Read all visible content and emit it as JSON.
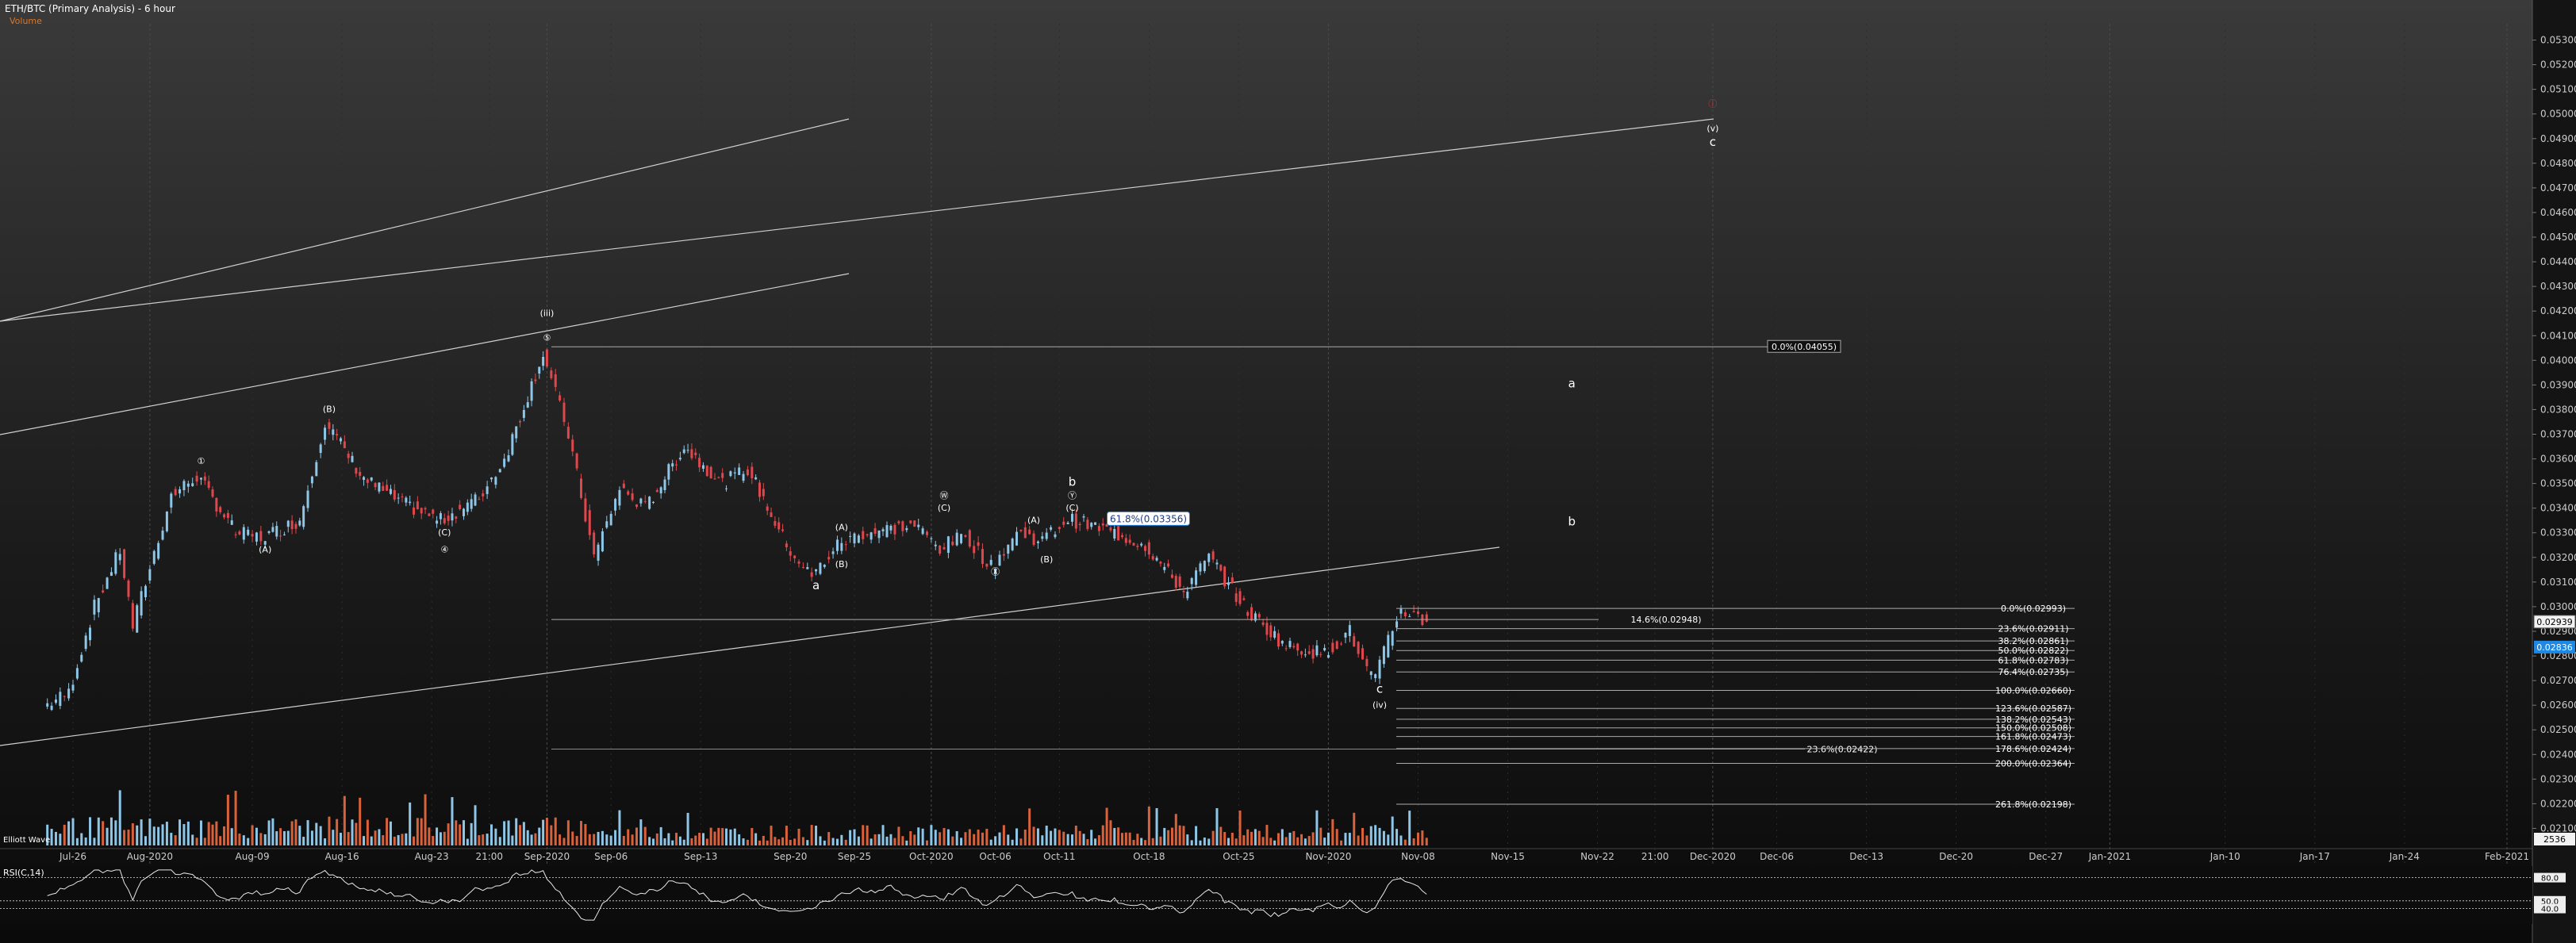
{
  "header": {
    "title": "ETH/BTC (Primary Analysis) - 6 hour",
    "volume_label": "Volume"
  },
  "volume_pane_label": "Elliott Wave",
  "chart_data": [
    {
      "type": "candlestick",
      "title": "ETH/BTC (Primary Analysis) - 6 hour",
      "x_tick_labels": [
        "Jul-26",
        "Aug-2020",
        "Aug-09",
        "Aug-16",
        "Aug-23",
        "21:00",
        "Sep-2020",
        "Sep-06",
        "Sep-13",
        "Sep-20",
        "Sep-25",
        "Oct-2020",
        "Oct-06",
        "Oct-11",
        "Oct-18",
        "Oct-25",
        "Nov-2020",
        "Nov-08",
        "Nov-15",
        "Nov-22",
        "21:00",
        "Dec-2020",
        "Dec-06",
        "Dec-13",
        "Dec-20",
        "Dec-27",
        "Jan-2021",
        "Jan-10",
        "Jan-17",
        "Jan-24",
        "Feb-2021"
      ],
      "y_tick_labels": [
        "0.02100",
        "0.02200",
        "0.02300",
        "0.02400",
        "0.02500",
        "0.02600",
        "0.02700",
        "0.02800",
        "0.02900",
        "0.03000",
        "0.03100",
        "0.03200",
        "0.03300",
        "0.03400",
        "0.03500",
        "0.03600",
        "0.03700",
        "0.03800",
        "0.03900",
        "0.04000",
        "0.04100",
        "0.04200",
        "0.04300",
        "0.04400",
        "0.04500",
        "0.04600",
        "0.04700",
        "0.04800",
        "0.04900",
        "0.05000",
        "0.05100",
        "0.05200",
        "0.05300"
      ],
      "ylim": [
        0.0205,
        0.0535
      ],
      "price_path": [
        [
          "Jul-24",
          0.02595
        ],
        [
          "Jul-26",
          0.0265
        ],
        [
          "Jul-28",
          0.03
        ],
        [
          "Jul-30",
          0.0323
        ],
        [
          "Jul-31",
          0.0292
        ],
        [
          "Aug-01",
          0.031
        ],
        [
          "Aug-03",
          0.0345
        ],
        [
          "Aug-05",
          0.0353
        ],
        [
          "Aug-08",
          0.033
        ],
        [
          "Aug-10",
          0.0328
        ],
        [
          "Aug-13",
          0.0335
        ],
        [
          "Aug-15",
          0.0375
        ],
        [
          "Aug-18",
          0.0352
        ],
        [
          "Aug-21",
          0.0342
        ],
        [
          "Aug-24",
          0.0335
        ],
        [
          "Aug-27",
          0.0344
        ],
        [
          "Aug-29",
          0.036
        ],
        [
          "Sep-01",
          0.0403
        ],
        [
          "Sep-03",
          0.037
        ],
        [
          "Sep-05",
          0.032
        ],
        [
          "Sep-07",
          0.0348
        ],
        [
          "Sep-09",
          0.034
        ],
        [
          "Sep-12",
          0.0365
        ],
        [
          "Sep-15",
          0.035
        ],
        [
          "Sep-17",
          0.0356
        ],
        [
          "Sep-20",
          0.0325
        ],
        [
          "Sep-22",
          0.0312
        ],
        [
          "Sep-24",
          0.0325
        ],
        [
          "Sep-26",
          0.033
        ],
        [
          "Sep-30",
          0.0333
        ],
        [
          "Oct-02",
          0.0324
        ],
        [
          "Oct-04",
          0.0329
        ],
        [
          "Oct-06",
          0.0316
        ],
        [
          "Oct-08",
          0.033
        ],
        [
          "Oct-10",
          0.0327
        ],
        [
          "Oct-12",
          0.03356
        ],
        [
          "Oct-15",
          0.0331
        ],
        [
          "Oct-18",
          0.0325
        ],
        [
          "Oct-21",
          0.0306
        ],
        [
          "Oct-23",
          0.032
        ],
        [
          "Oct-26",
          0.0298
        ],
        [
          "Oct-29",
          0.0284
        ],
        [
          "Nov-01",
          0.0281
        ],
        [
          "Nov-03",
          0.029
        ],
        [
          "Nov-04",
          0.0277
        ],
        [
          "Nov-05",
          0.027
        ],
        [
          "Nov-06",
          0.0287
        ],
        [
          "Nov-07",
          0.0299
        ],
        [
          "Nov-09",
          0.02939
        ]
      ],
      "last_price": "0.02939",
      "secondary_price": "0.02836",
      "fib_levels_right": [
        {
          "label": "0.0%(0.02993)",
          "value": 0.02993
        },
        {
          "label": "23.6%(0.02911)",
          "value": 0.02911
        },
        {
          "label": "38.2%(0.02861)",
          "value": 0.02861
        },
        {
          "label": "50.0%(0.02822)",
          "value": 0.02822
        },
        {
          "label": "61.8%(0.02783)",
          "value": 0.02783
        },
        {
          "label": "76.4%(0.02735)",
          "value": 0.02735
        },
        {
          "label": "100.0%(0.02660)",
          "value": 0.0266
        },
        {
          "label": "123.6%(0.02587)",
          "value": 0.02587
        },
        {
          "label": "138.2%(0.02543)",
          "value": 0.02543
        },
        {
          "label": "150.0%(0.02508)",
          "value": 0.02508
        },
        {
          "label": "161.8%(0.02473)",
          "value": 0.02473
        },
        {
          "label": "178.6%(0.02424)",
          "value": 0.02424
        },
        {
          "label": "200.0%(0.02364)",
          "value": 0.02364
        },
        {
          "label": "261.8%(0.02198)",
          "value": 0.02198
        }
      ],
      "fib_levels_other": [
        {
          "label": "0.0%(0.04055)",
          "value": 0.04055
        },
        {
          "label": "14.6%(0.02948)",
          "value": 0.02948
        },
        {
          "label": "23.6%(0.02422)",
          "value": 0.02422
        },
        {
          "label": "61.8%(0.03356)",
          "value": 0.03356
        }
      ],
      "wave_labels": [
        {
          "text": "①",
          "x": "Aug-05",
          "y": 0.0358
        },
        {
          "text": "(A)",
          "x": "Aug-10",
          "y": 0.0322
        },
        {
          "text": "(B)",
          "x": "Aug-15",
          "y": 0.0379
        },
        {
          "text": "(C)",
          "x": "Aug-24",
          "y": 0.0329
        },
        {
          "text": "④",
          "x": "Aug-24",
          "y": 0.0322
        },
        {
          "text": "(iii)",
          "x": "Sep-01",
          "y": 0.0418
        },
        {
          "text": "⑤",
          "x": "Sep-01",
          "y": 0.0408
        },
        {
          "text": "(A)",
          "x": "Sep-24",
          "y": 0.0331
        },
        {
          "text": "(B)",
          "x": "Sep-24",
          "y": 0.0316
        },
        {
          "text": "a",
          "x": "Sep-22",
          "y": 0.0307
        },
        {
          "text": "Ⓦ",
          "x": "Oct-02",
          "y": 0.0344
        },
        {
          "text": "(C)",
          "x": "Oct-02",
          "y": 0.0339
        },
        {
          "text": "Ⓧ",
          "x": "Oct-06",
          "y": 0.0313
        },
        {
          "text": "(A)",
          "x": "Oct-09",
          "y": 0.0334
        },
        {
          "text": "(B)",
          "x": "Oct-10",
          "y": 0.0318
        },
        {
          "text": "b",
          "x": "Oct-12",
          "y": 0.0349
        },
        {
          "text": "Ⓨ",
          "x": "Oct-12",
          "y": 0.0344
        },
        {
          "text": "(C)",
          "x": "Oct-12",
          "y": 0.0339
        },
        {
          "text": "c",
          "x": "Nov-05",
          "y": 0.0265
        },
        {
          "text": "(iv)",
          "x": "Nov-05",
          "y": 0.0259
        },
        {
          "text": "ⓘ",
          "x": "Dec-01",
          "y": 0.0503
        },
        {
          "text": "(v)",
          "x": "Dec-01",
          "y": 0.0493
        },
        {
          "text": "c",
          "x": "Dec-01",
          "y": 0.0487
        },
        {
          "text": "a",
          "x": "Nov-20",
          "y": 0.0389
        },
        {
          "text": "b",
          "x": "Nov-20",
          "y": 0.0333
        }
      ],
      "volume": {
        "right_label": "2536"
      },
      "rsi": {
        "label": "RSI(C,14)",
        "y_tick_labels": [
          "80.0",
          "50.0",
          "40.0"
        ],
        "levels": [
          80,
          50,
          40
        ]
      }
    }
  ],
  "colors": {
    "up": "#8ec6e8",
    "down": "#e0474c",
    "volume": "#d9623b",
    "text": "#ffffff",
    "fib": "#cccccc",
    "highlight": "#1e88e5"
  }
}
